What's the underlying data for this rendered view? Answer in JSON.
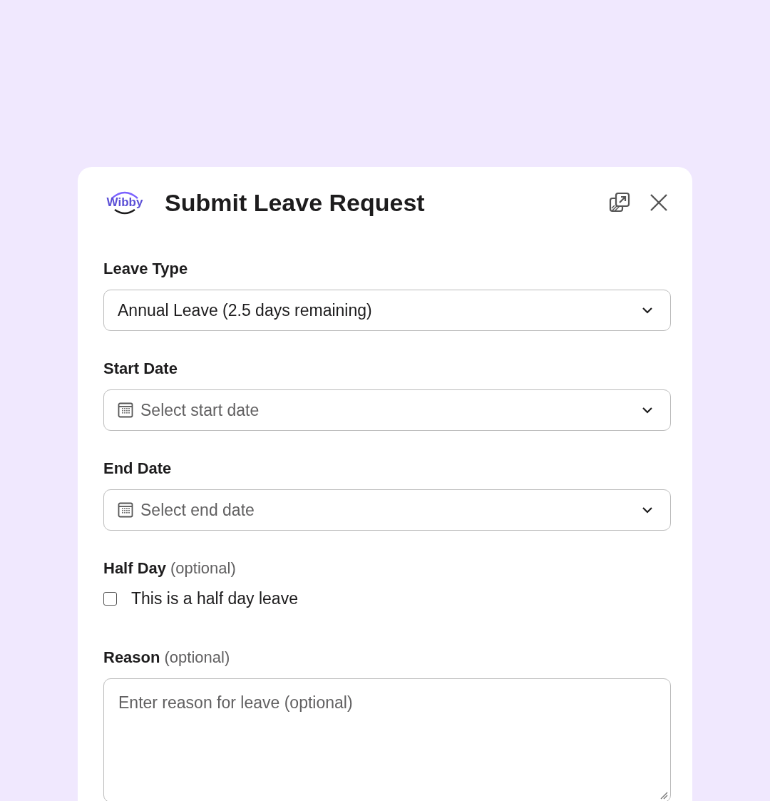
{
  "dialog": {
    "logo": "Wibby",
    "title": "Submit Leave Request"
  },
  "fields": [
    {
      "kind": "select",
      "label": "Leave Type",
      "value": "Annual Leave (2.5 days remaining)"
    },
    {
      "kind": "date",
      "label": "Start Date",
      "placeholder": "Select start date"
    },
    {
      "kind": "date",
      "label": "End Date",
      "placeholder": "Select end date"
    },
    {
      "kind": "checkbox",
      "label": "Half Day",
      "note": "(optional)",
      "option": "This is a half day leave",
      "checked": false
    },
    {
      "kind": "textarea",
      "label": "Reason",
      "note": "(optional)",
      "placeholder": "Enter reason for leave (optional)"
    }
  ]
}
